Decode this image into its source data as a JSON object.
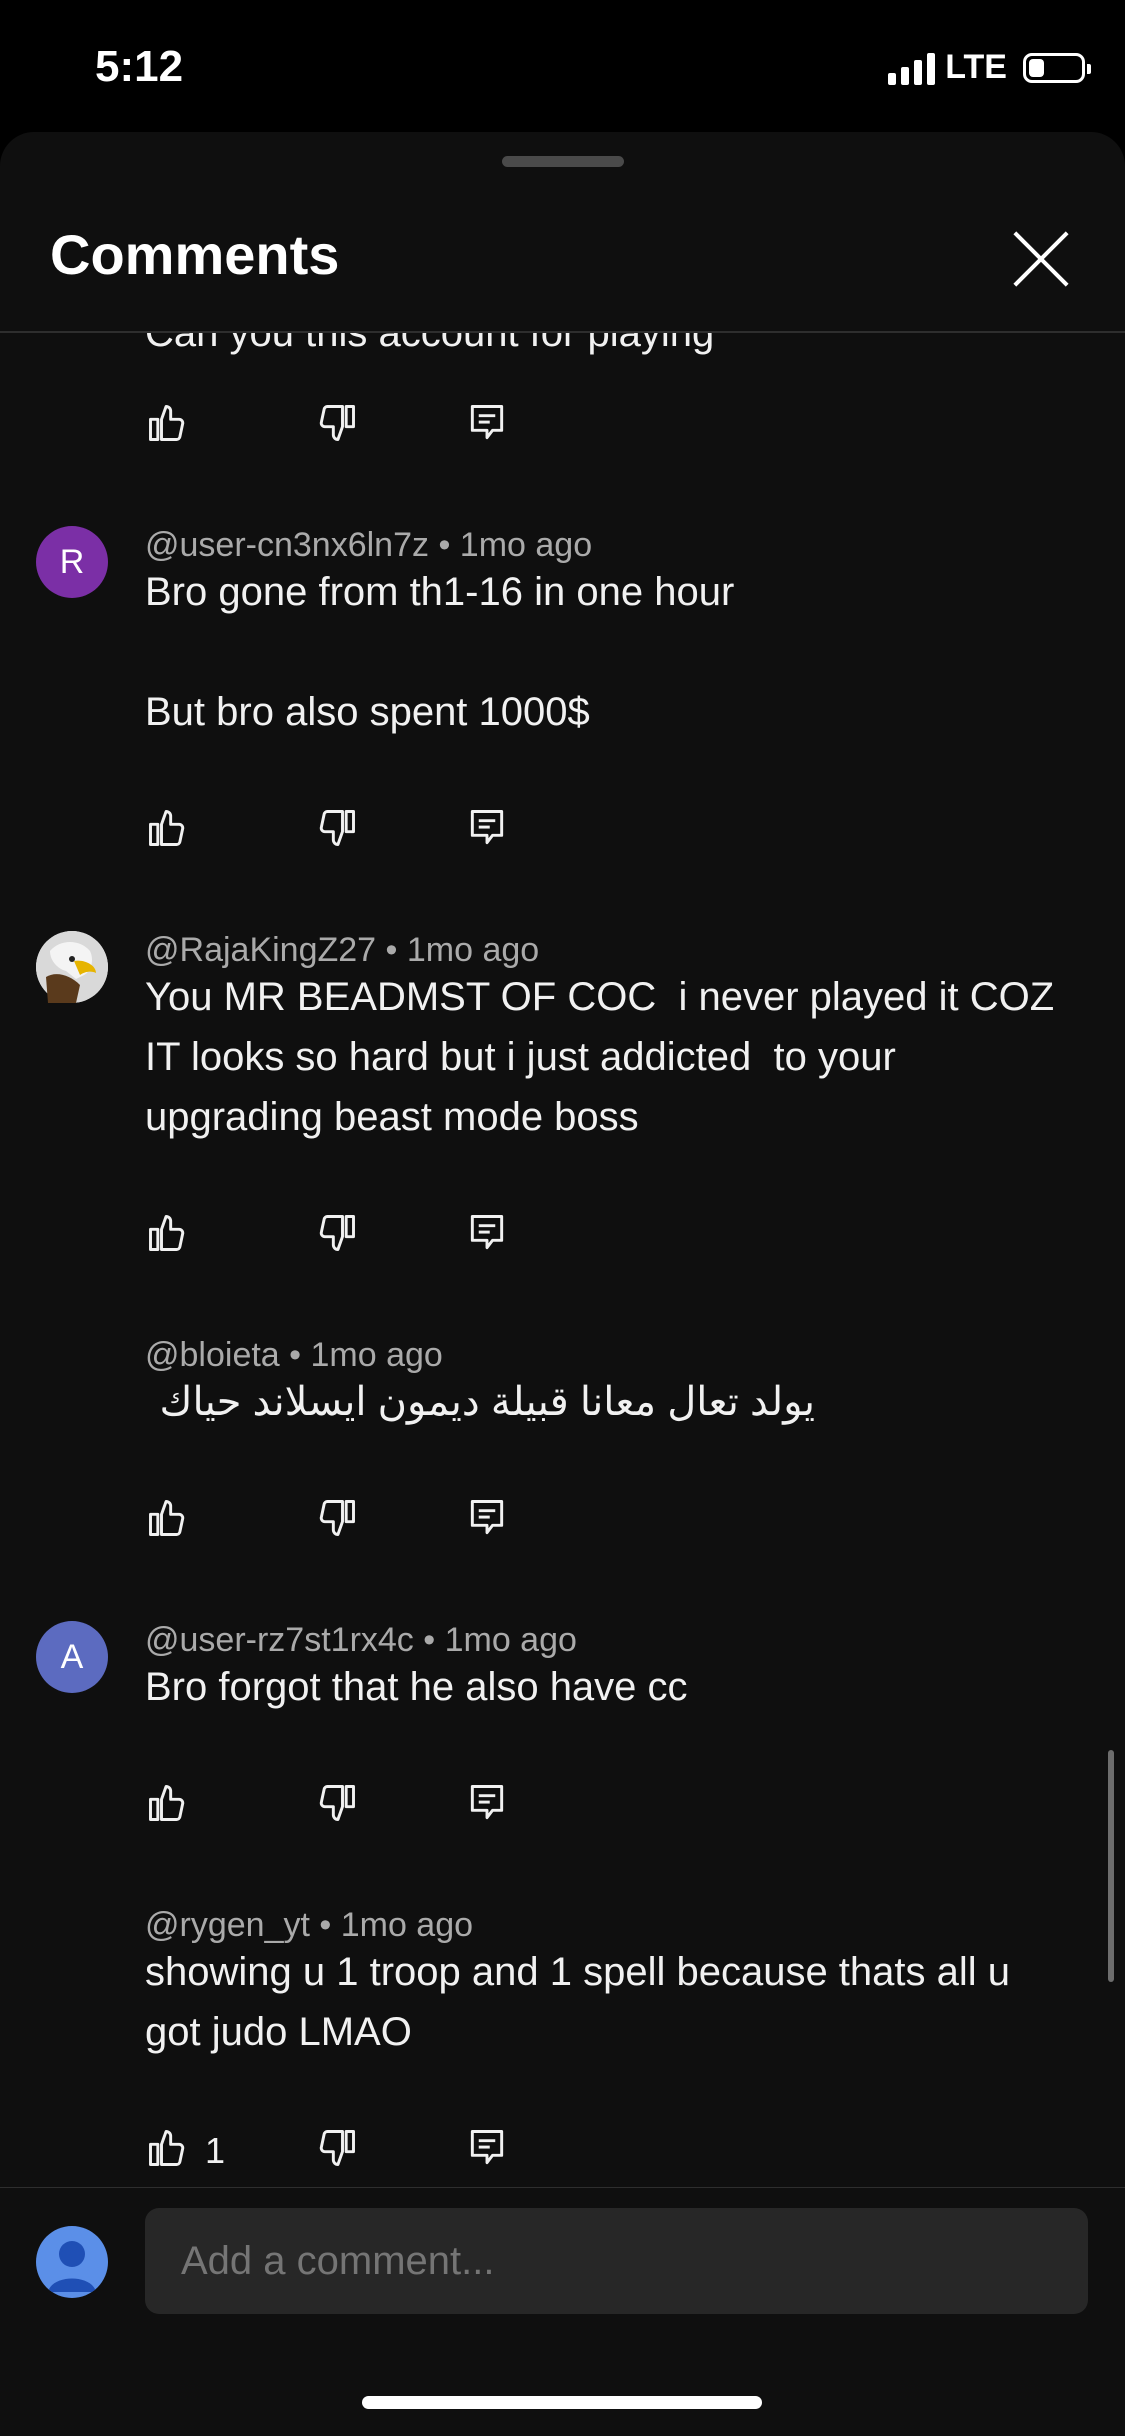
{
  "status_bar": {
    "time": "5:12",
    "network": "LTE",
    "battery_fraction": 0.3
  },
  "sheet": {
    "title": "Comments"
  },
  "cut_off_text": "Can you this account for playing",
  "comments": [
    {
      "author": "@user-cn3nx6ln7z",
      "age": "1mo ago",
      "avatar_letter": "R",
      "avatar_color": "#7b2fa6",
      "text": "Bro gone from th1-16 in one hour\n\nBut bro also spent 1000$",
      "likes": ""
    },
    {
      "author": "@RajaKingZ27",
      "age": "1mo ago",
      "avatar_letter": "",
      "avatar_icon": "eagle-avatar",
      "text": "You MR BEADMST OF COC  i never played it COZ IT looks so hard but i just addicted  to your upgrading beast mode boss",
      "likes": ""
    },
    {
      "author": "@bloieta",
      "age": "1mo ago",
      "avatar_letter": "",
      "text": "يولد تعال معانا قبيلة ديمون ايسلاند حياك",
      "likes": ""
    },
    {
      "author": "@user-rz7st1rx4c",
      "age": "1mo ago",
      "avatar_letter": "A",
      "avatar_color": "#5c6bc0",
      "text": "Bro forgot that he also have cc",
      "likes": ""
    },
    {
      "author": "@rygen_yt",
      "age": "1mo ago",
      "avatar_letter": "",
      "text": "showing u 1 troop and 1 spell because thats all u got judo LMAO",
      "likes": "1"
    }
  ],
  "composer": {
    "placeholder": "Add a comment..."
  },
  "icons": {
    "like": "thumbs-up-icon",
    "dislike": "thumbs-down-icon",
    "reply": "reply-icon",
    "close": "close-icon"
  }
}
